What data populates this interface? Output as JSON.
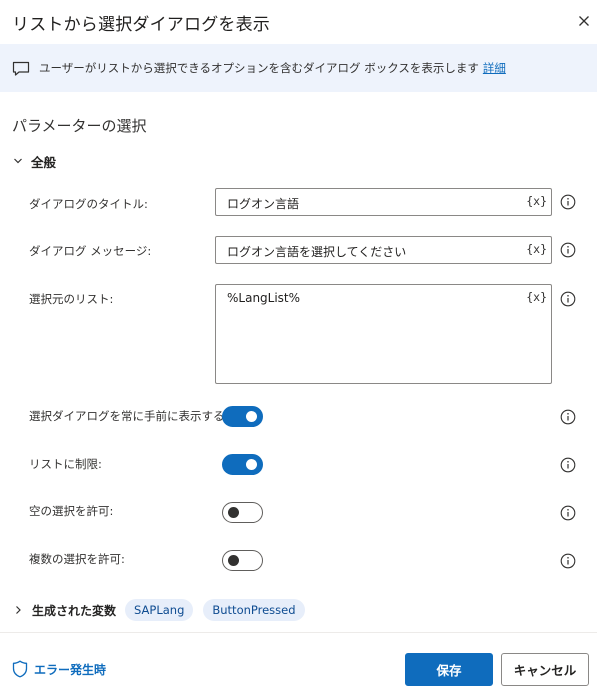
{
  "dialog": {
    "title": "リストから選択ダイアログを表示",
    "close_icon": "close-icon"
  },
  "banner": {
    "description": "ユーザーがリストから選択できるオプションを含むダイアログ ボックスを表示します",
    "link": "詳細",
    "icon": "chat-icon"
  },
  "section": {
    "title": "パラメーターの選択"
  },
  "general_group": {
    "label": "全般",
    "expanded": true
  },
  "fields": {
    "dialog_title": {
      "label": "ダイアログのタイトル:",
      "value": "ログオン言語",
      "var_button": "{x}"
    },
    "dialog_message": {
      "label": "ダイアログ メッセージ:",
      "value": "ログオン言語を選択してください",
      "var_button": "{x}"
    },
    "list_source": {
      "label": "選択元のリスト:",
      "value": "%LangList%",
      "var_button": "{x}"
    }
  },
  "toggles": {
    "always_on_top": {
      "label": "選択ダイアログを常に手前に表示する:",
      "on": true
    },
    "limit_to_list": {
      "label": "リストに制限:",
      "on": true
    },
    "allow_empty": {
      "label": "空の選択を許可:",
      "on": false
    },
    "allow_multiple": {
      "label": "複数の選択を許可:",
      "on": false
    }
  },
  "produced_variables": {
    "label": "生成された変数",
    "chips": [
      "SAPLang",
      "ButtonPressed"
    ]
  },
  "footer": {
    "on_error": "エラー発生時",
    "save": "保存",
    "cancel": "キャンセル"
  },
  "colors": {
    "accent": "#0f6cbd",
    "banner_bg": "#eef3fc",
    "chip_bg": "#e7eefa"
  }
}
